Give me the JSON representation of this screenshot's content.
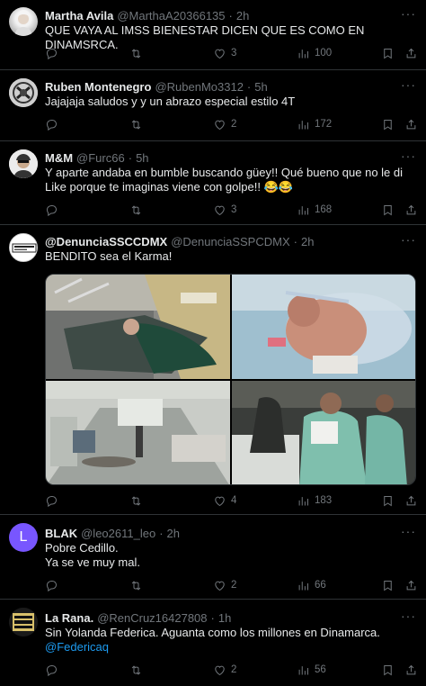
{
  "tweets": [
    {
      "name": "Martha Avila",
      "handle": "@MarthaA20366135",
      "time": "2h",
      "text": "QUE VAYA AL IMSS BIENESTAR DICEN QUE ES COMO EN DINAMSRCA.",
      "replies": "",
      "retweets": "",
      "likes": "3",
      "views": "100"
    },
    {
      "name": "Ruben Montenegro",
      "handle": "@RubenMo3312",
      "time": "5h",
      "text": "Jajajaja saludos y y un abrazo especial estilo 4T",
      "replies": "",
      "retweets": "",
      "likes": "2",
      "views": "172"
    },
    {
      "name": "M&M",
      "handle": "@Furc66",
      "time": "5h",
      "text": "Y aparte andaba en bumble buscando güey!! Qué bueno que no le di Like porque te imaginas viene con golpe!! 😂😂",
      "replies": "",
      "retweets": "",
      "likes": "3",
      "views": "168"
    },
    {
      "name": "@DenunciaSSCCDMX",
      "handle": "@DenunciaSSPCDMX",
      "time": "2h",
      "text": "BENDITO sea el Karma!",
      "replies": "",
      "retweets": "",
      "likes": "4",
      "views": "183"
    },
    {
      "name": "BLAK",
      "handle": "@leo2611_leo",
      "time": "2h",
      "text_line1": "Pobre Cedillo.",
      "text_line2": "Ya se ve muy mal.",
      "avatar_letter": "L",
      "replies": "",
      "retweets": "",
      "likes": "2",
      "views": "66"
    },
    {
      "name": "La Rana.",
      "handle": "@RenCruz16427808",
      "time": "1h",
      "text": "Sin Yolanda Federica. Aguanta como los millones en Dinamarca.",
      "mention": "@Federicaq",
      "replies": "",
      "retweets": "",
      "likes": "2",
      "views": "56"
    }
  ],
  "dot": "·",
  "more_glyph": "···",
  "icons": {
    "reply": "reply-icon",
    "retweet": "retweet-icon",
    "like": "heart-icon",
    "views": "views-icon",
    "bookmark": "bookmark-icon",
    "share": "share-icon",
    "more": "more-icon"
  },
  "colors": {
    "background": "#000000",
    "text": "#e7e9ea",
    "muted": "#71767b",
    "link": "#1d9bf0",
    "divider": "#2f3336",
    "avatar_L": "#7856ff"
  }
}
